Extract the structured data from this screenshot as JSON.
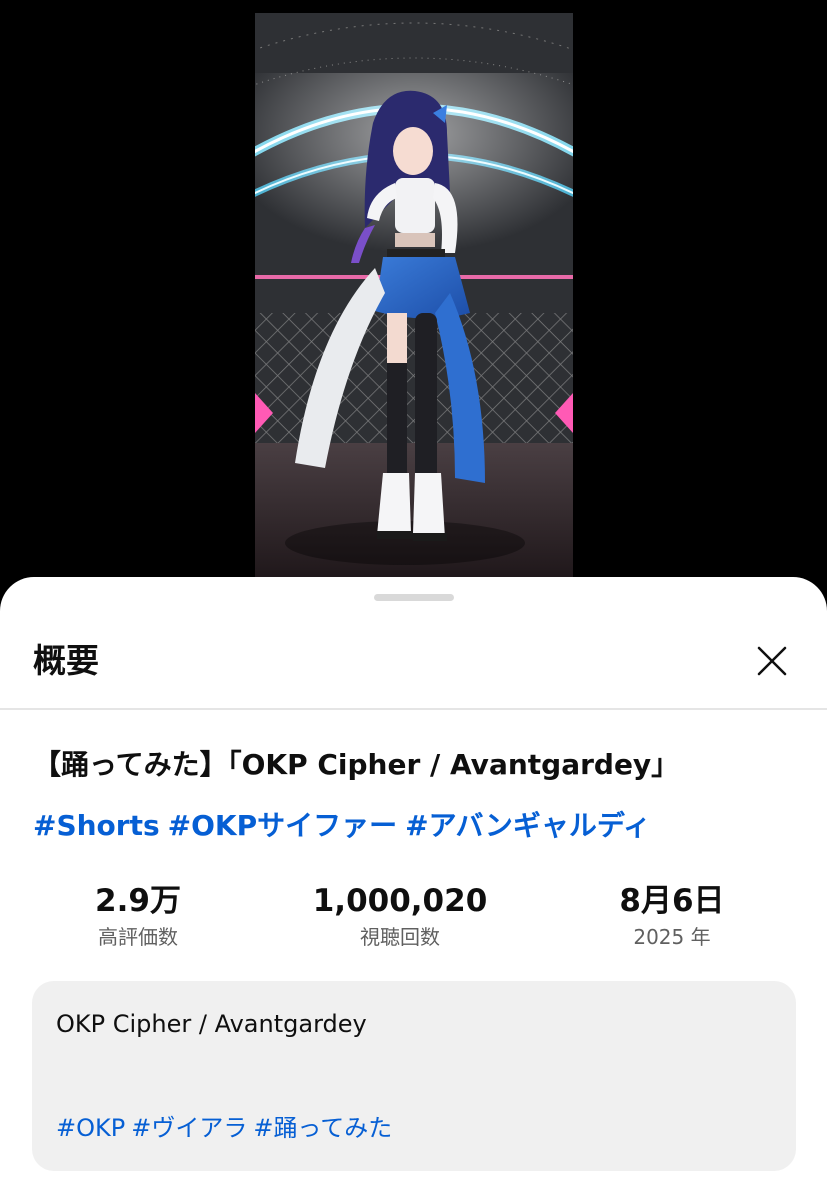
{
  "sheet": {
    "title": "概要",
    "close_icon": "close-icon"
  },
  "video": {
    "title": "【踊ってみた】「OKP Cipher / Avantgardey」",
    "title_hashtags": [
      "#Shorts",
      "#OKPサイファー",
      "#アバンギャルディ"
    ]
  },
  "stats": {
    "likes": {
      "value": "2.9万",
      "label": "高評価数"
    },
    "views": {
      "value": "1,000,020",
      "label": "視聴回数"
    },
    "date": {
      "value": "8月6日",
      "label": "2025 年"
    }
  },
  "description": {
    "text": "OKP Cipher / Avantgardey",
    "hashtags": [
      "#OKP",
      "#ヴイアラ",
      "#踊ってみた"
    ]
  },
  "colors": {
    "link": "#065fd4",
    "primary_text": "#0f0f0f",
    "secondary_text": "#606060",
    "desc_bg": "#f0f0f0"
  }
}
